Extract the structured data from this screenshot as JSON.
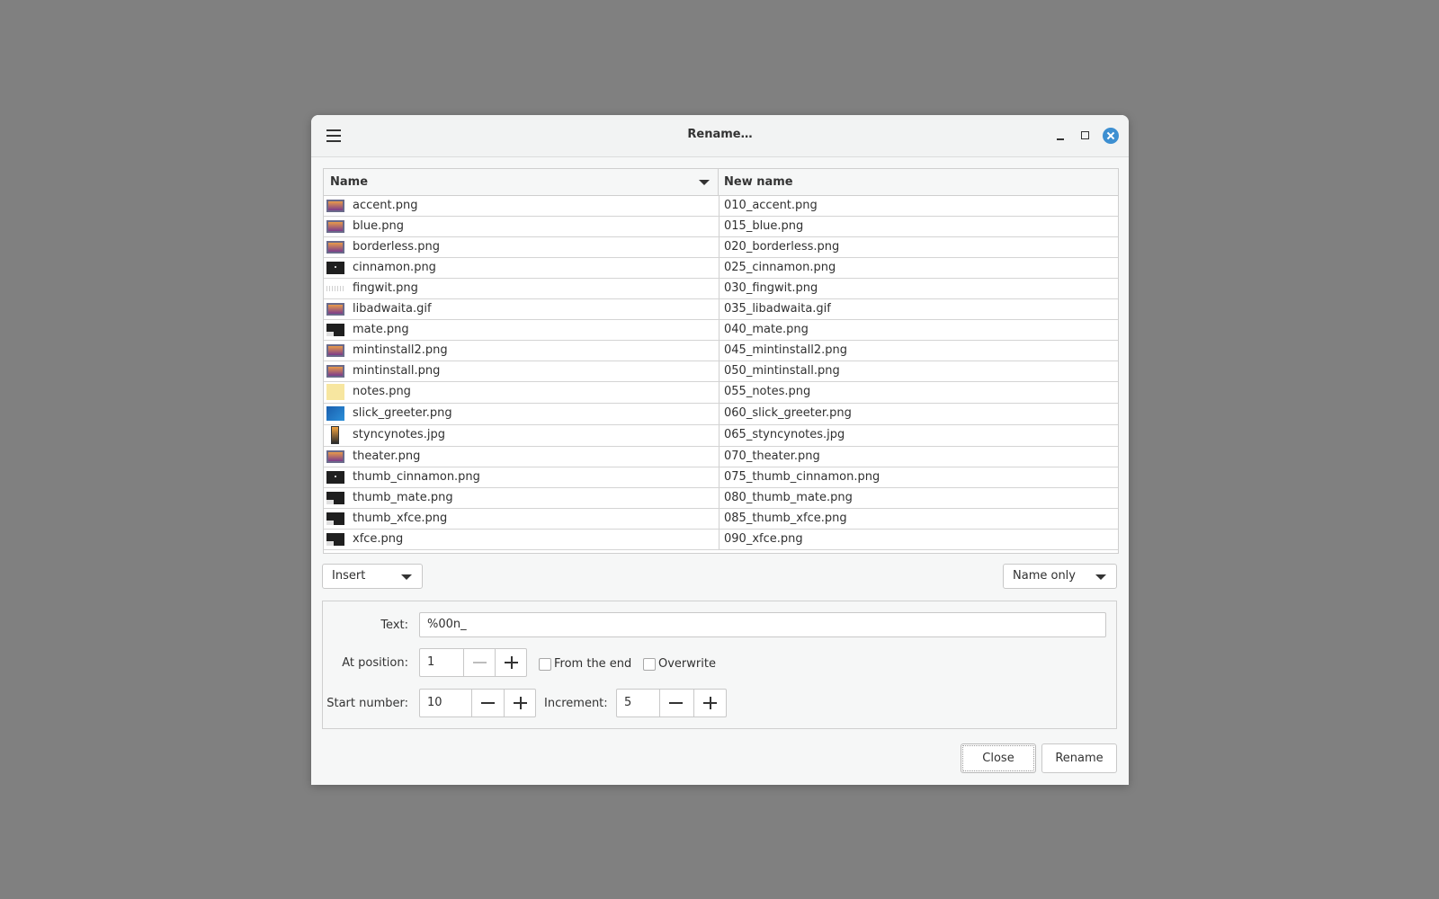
{
  "window": {
    "title": "Rename…"
  },
  "table": {
    "columns": {
      "name": "Name",
      "new_name": "New name"
    },
    "rows": [
      {
        "name": "accent.png",
        "new_name": "010_accent.png",
        "thumb": "pic"
      },
      {
        "name": "blue.png",
        "new_name": "015_blue.png",
        "thumb": "pic"
      },
      {
        "name": "borderless.png",
        "new_name": "020_borderless.png",
        "thumb": "pic"
      },
      {
        "name": "cinnamon.png",
        "new_name": "025_cinnamon.png",
        "thumb": "dark"
      },
      {
        "name": "fingwit.png",
        "new_name": "030_fingwit.png",
        "thumb": "dots"
      },
      {
        "name": "libadwaita.gif",
        "new_name": "035_libadwaita.gif",
        "thumb": "pic"
      },
      {
        "name": "mate.png",
        "new_name": "040_mate.png",
        "thumb": "darkwin"
      },
      {
        "name": "mintinstall2.png",
        "new_name": "045_mintinstall2.png",
        "thumb": "pic"
      },
      {
        "name": "mintinstall.png",
        "new_name": "050_mintinstall.png",
        "thumb": "pic"
      },
      {
        "name": "notes.png",
        "new_name": "055_notes.png",
        "thumb": "yellow"
      },
      {
        "name": "slick_greeter.png",
        "new_name": "060_slick_greeter.png",
        "thumb": "blue"
      },
      {
        "name": "styncynotes.jpg",
        "new_name": "065_styncynotes.jpg",
        "thumb": "phone"
      },
      {
        "name": "theater.png",
        "new_name": "070_theater.png",
        "thumb": "pic"
      },
      {
        "name": "thumb_cinnamon.png",
        "new_name": "075_thumb_cinnamon.png",
        "thumb": "dark"
      },
      {
        "name": "thumb_mate.png",
        "new_name": "080_thumb_mate.png",
        "thumb": "darkwin"
      },
      {
        "name": "thumb_xfce.png",
        "new_name": "085_thumb_xfce.png",
        "thumb": "darkwin"
      },
      {
        "name": "xfce.png",
        "new_name": "090_xfce.png",
        "thumb": "darkwin"
      }
    ]
  },
  "controls": {
    "mode_select": "Insert",
    "scope_select": "Name only",
    "text_label": "Text:",
    "text_value": "%00n_",
    "position_label": "At position:",
    "position_value": "1",
    "from_end_label": "From the end",
    "from_end_checked": false,
    "overwrite_label": "Overwrite",
    "overwrite_checked": false,
    "start_label": "Start number:",
    "start_value": "10",
    "increment_label": "Increment:",
    "increment_value": "5"
  },
  "buttons": {
    "close": "Close",
    "rename": "Rename"
  },
  "colors": {
    "accent": "#3d8fd1",
    "background": "#808080",
    "window": "#f6f7f7"
  }
}
